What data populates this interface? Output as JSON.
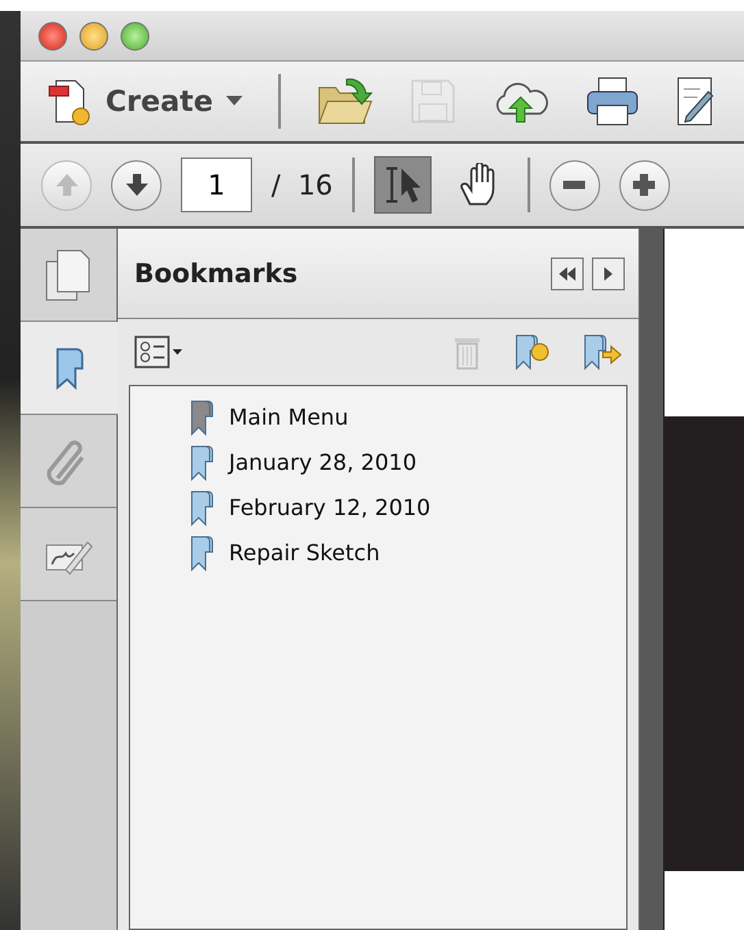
{
  "toolbar": {
    "create": {
      "label": "Create"
    },
    "buttons": [
      {
        "kind": "open",
        "disabled": false
      },
      {
        "kind": "save",
        "disabled": true
      },
      {
        "kind": "upload",
        "disabled": false
      },
      {
        "kind": "print",
        "disabled": false
      },
      {
        "kind": "sign",
        "disabled": false
      }
    ]
  },
  "navigation": {
    "previous_disabled": true,
    "next_disabled": false,
    "page": "1",
    "total": "/  16",
    "tools": [
      {
        "kind": "select",
        "selected": true
      },
      {
        "kind": "hand",
        "selected": false
      }
    ],
    "zoom": [
      {
        "kind": "out"
      },
      {
        "kind": "in"
      }
    ]
  },
  "rail": [
    {
      "kind": "pages",
      "selected": false
    },
    {
      "kind": "bookmarks",
      "selected": true
    },
    {
      "kind": "attachments",
      "selected": false
    },
    {
      "kind": "signatures",
      "selected": false
    }
  ],
  "panel": {
    "title": "Bookmarks",
    "delete_disabled": true,
    "bookmarks": [
      {
        "label": "Main Menu",
        "color": "#8a8a8a"
      },
      {
        "label": "January 28, 2010",
        "color": "#a9cde8"
      },
      {
        "label": "February 12, 2010",
        "color": "#a9cde8"
      },
      {
        "label": "Repair Sketch",
        "color": "#a9cde8"
      }
    ]
  }
}
